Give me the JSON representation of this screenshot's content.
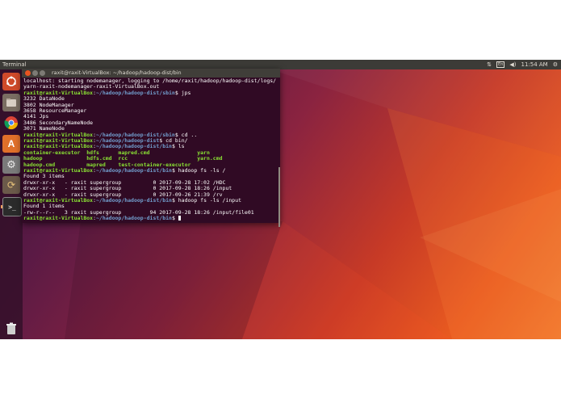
{
  "topbar": {
    "app_title": "Terminal",
    "keyboard": "En",
    "time": "11:54 AM"
  },
  "launcher": {
    "items": [
      {
        "icon": "ubuntu-logo-icon"
      },
      {
        "icon": "files-icon"
      },
      {
        "icon": "chrome-icon"
      },
      {
        "icon": "software-center-icon"
      },
      {
        "icon": "settings-icon"
      },
      {
        "icon": "software-updater-icon"
      },
      {
        "icon": "terminal-icon"
      },
      {
        "icon": "trash-icon"
      }
    ]
  },
  "terminal": {
    "title": "raxit@raxit-VirtualBox: ~/hadoop/hadoop-dist/bin",
    "lines": [
      {
        "t": "localhost: starting nodemanager, logging to /home/raxit/hadoop/hadoop-dist/logs/"
      },
      {
        "t": "yarn-raxit-nodemanager-raxit-VirtualBox.out"
      },
      {
        "user": "raxit@raxit-VirtualBox",
        "path": "~/hadoop/hadoop-dist/sbin",
        "cmd": "$ jps"
      },
      {
        "t": "3232 DataNode"
      },
      {
        "t": "3802 NodeManager"
      },
      {
        "t": "3658 ResourceManager"
      },
      {
        "t": "4141 Jps"
      },
      {
        "t": "3486 SecondaryNameNode"
      },
      {
        "t": "3071 NameNode"
      },
      {
        "user": "raxit@raxit-VirtualBox",
        "path": "~/hadoop/hadoop-dist/sbin",
        "cmd": "$ cd .."
      },
      {
        "user": "raxit@raxit-VirtualBox",
        "path": "~/hadoop/hadoop-dist",
        "cmd": "$ cd bin/"
      },
      {
        "user": "raxit@raxit-VirtualBox",
        "path": "~/hadoop/hadoop-dist/bin",
        "cmd": "$ ls"
      },
      {
        "exec": "container-executor  hdfs      mapred.cmd               yarn"
      },
      {
        "exec": "hadoop              hdfs.cmd  rcc                      yarn.cmd"
      },
      {
        "exec": "hadoop.cmd          mapred    test-container-executor"
      },
      {
        "user": "raxit@raxit-VirtualBox",
        "path": "~/hadoop/hadoop-dist/bin",
        "cmd": "$ hadoop fs -ls /"
      },
      {
        "t": "Found 3 items"
      },
      {
        "t": "drwxr-xr-x   - raxit supergroup          0 2017-09-28 17:02 /HDC"
      },
      {
        "t": "drwxr-xr-x   - raxit supergroup          0 2017-09-28 18:26 /input"
      },
      {
        "t": "drwxr-xr-x   - raxit supergroup          0 2017-09-26 21:39 /rv"
      },
      {
        "user": "raxit@raxit-VirtualBox",
        "path": "~/hadoop/hadoop-dist/bin",
        "cmd": "$ hadoop fs -ls /input"
      },
      {
        "t": "Found 1 items"
      },
      {
        "t": "-rw-r--r--   3 raxit supergroup         94 2017-09-28 18:26 /input/file01"
      },
      {
        "user": "raxit@raxit-VirtualBox",
        "path": "~/hadoop/hadoop-dist/bin",
        "cmd": "$ "
      }
    ]
  },
  "colors": {
    "prompt_user": "#8ae234",
    "prompt_path": "#729fcf",
    "terminal_bg": "#300a24",
    "close": "#e95420",
    "panel": "#3c3b37"
  }
}
